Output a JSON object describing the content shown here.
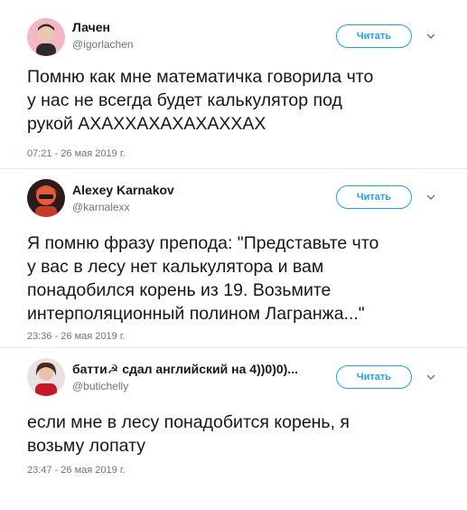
{
  "follow_label": "Читать",
  "accent_color": "#1da1f2",
  "tweets": [
    {
      "name": "Лачен",
      "handle": "@igorlachen",
      "text": "Помню как мне математичка говорила что\nу нас не всегда будет калькулятор под\nрукой АХАХХАХАХАХАХХАХ",
      "date": "07:21 - 26 мая 2019 г."
    },
    {
      "name": "Alexey Karnakov",
      "handle": "@karnalexx",
      "text": "Я помню фразу препода: \"Представьте что\nу вас в лесу нет калькулятора и вам\nпонадобился корень из 19. Возьмите\nинтерполяционный полином Лагранжа...\"",
      "date": "23:36 - 26 мая 2019 г."
    },
    {
      "name": "батти☭ сдал английский на 4))0)0)...",
      "handle": "@butichelly",
      "text": "если мне в лесу понадобится корень, я\nвозьму лопату",
      "date": "23:47 - 26 мая 2019 г."
    }
  ]
}
